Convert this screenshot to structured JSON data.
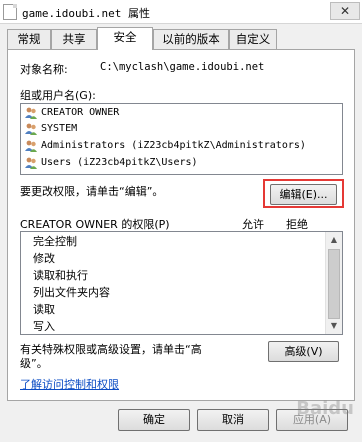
{
  "window": {
    "title": "game.idoubi.net 属性",
    "close_glyph": "✕"
  },
  "tabs": [
    {
      "label": "常规"
    },
    {
      "label": "共享"
    },
    {
      "label": "安全"
    },
    {
      "label": "以前的版本"
    },
    {
      "label": "自定义"
    }
  ],
  "security": {
    "object_name_label": "对象名称:",
    "object_name_value": "C:\\myclash\\game.idoubi.net",
    "group_label": "组或用户名(G):",
    "users": [
      {
        "name": "CREATOR OWNER"
      },
      {
        "name": "SYSTEM"
      },
      {
        "name": "Administrators (iZ23cb4pitkZ\\Administrators)"
      },
      {
        "name": "Users (iZ23cb4pitkZ\\Users)"
      }
    ],
    "change_perm_text": "要更改权限，请单击“编辑”。",
    "edit_button": "编辑(E)...",
    "perm_header": "CREATOR OWNER 的权限(P)",
    "allow_header": "允许",
    "deny_header": "拒绝",
    "permissions": [
      {
        "name": "完全控制"
      },
      {
        "name": "修改"
      },
      {
        "name": "读取和执行"
      },
      {
        "name": "列出文件夹内容"
      },
      {
        "name": "读取"
      },
      {
        "name": "写入"
      }
    ],
    "advanced_text_line1": "有关特殊权限或高级设置，请单击“高",
    "advanced_text_line2": "级”。",
    "advanced_button": "高级(V)",
    "learn_link": "了解访问控制和权限"
  },
  "footer": {
    "ok_button": "确定",
    "cancel_button": "取消",
    "apply_button": "应用(A)"
  },
  "watermark": "Baidu"
}
